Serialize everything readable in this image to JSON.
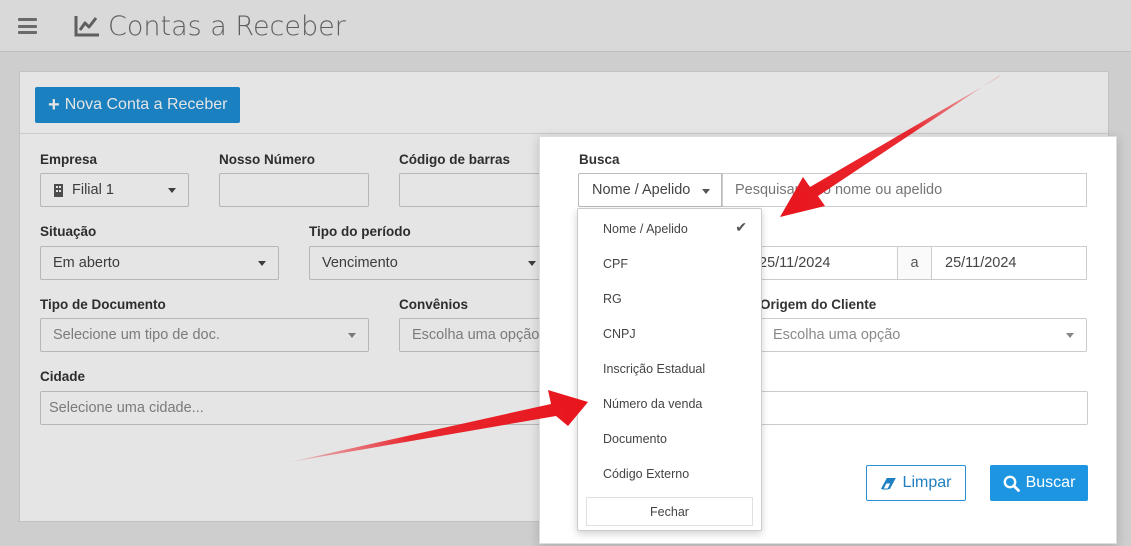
{
  "header": {
    "menu_icon": "hamburger-icon",
    "title_icon": "line-chart-icon",
    "title": "Contas a Receber"
  },
  "panel": {
    "new_button": "Nova Conta a Receber",
    "new_button_icon": "plus-icon",
    "fields": {
      "empresa": {
        "label": "Empresa",
        "value": "Filial 1",
        "icon": "building-icon"
      },
      "nosso_numero": {
        "label": "Nosso Número",
        "value": ""
      },
      "codigo_barras": {
        "label": "Código de barras",
        "value": ""
      },
      "situacao": {
        "label": "Situação",
        "value": "Em aberto"
      },
      "tipo_periodo": {
        "label": "Tipo do período",
        "value": "Vencimento"
      },
      "tipo_documento": {
        "label": "Tipo de Documento",
        "placeholder": "Selecione um tipo de doc."
      },
      "convenios": {
        "label": "Convênios",
        "placeholder": "Escolha uma opção"
      },
      "origem_cliente": {
        "label": "Origem do Cliente",
        "placeholder": "Escolha uma opção"
      },
      "cidade": {
        "label": "Cidade",
        "placeholder": "Selecione uma cidade..."
      }
    }
  },
  "busca": {
    "label": "Busca",
    "selected": "Nome / Apelido",
    "placeholder": "Pesquisar pelo nome ou apelido",
    "date_from": "25/11/2024",
    "date_sep": "a",
    "date_to": "25/11/2024",
    "options": [
      "Nome / Apelido",
      "CPF",
      "RG",
      "CNPJ",
      "Inscrição Estadual",
      "Número da venda",
      "Documento",
      "Código Externo"
    ],
    "checked_index": 0,
    "close_label": "Fechar",
    "clear_label": "Limpar",
    "clear_icon": "eraser-icon",
    "search_label": "Buscar",
    "search_icon": "search-icon"
  },
  "colors": {
    "primary": "#1e95e0",
    "annotation_arrow": "#e8141c"
  }
}
